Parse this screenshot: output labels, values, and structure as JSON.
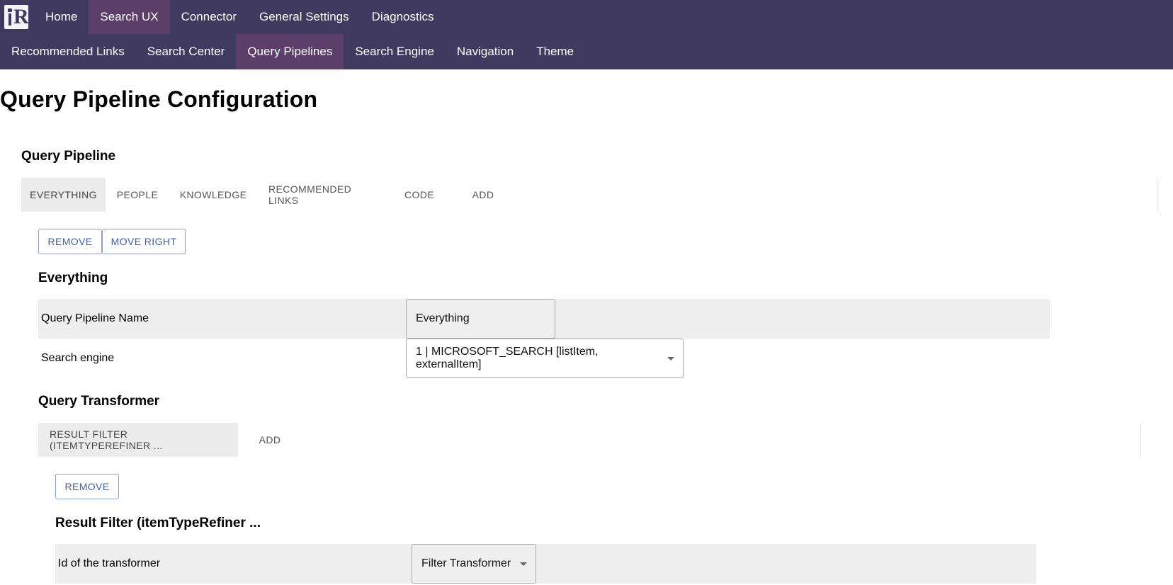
{
  "nav": {
    "top_items": [
      "Home",
      "Search UX",
      "Connector",
      "General Settings",
      "Diagnostics"
    ],
    "top_active": 1,
    "sub_items": [
      "Recommended Links",
      "Search Center",
      "Query Pipelines",
      "Search Engine",
      "Navigation",
      "Theme"
    ],
    "sub_active": 2,
    "colors": {
      "bar": "#403a60",
      "active": "#5b3f6a"
    }
  },
  "page": {
    "title": "Query Pipeline Configuration"
  },
  "pipeline": {
    "section_title": "Query Pipeline",
    "tabs": [
      "EVERYTHING",
      "PEOPLE",
      "KNOWLEDGE",
      "RECOMMENDED LINKS",
      "CODE",
      "ADD"
    ],
    "active_tab": 0,
    "remove_label": "REMOVE",
    "move_right_label": "MOVE RIGHT",
    "detail_title": "Everything",
    "name_label": "Query Pipeline Name",
    "name_value": "Everything",
    "engine_label": "Search engine",
    "engine_value": "1 | MICROSOFT_SEARCH [listItem, externalItem]"
  },
  "transformer": {
    "section_title": "Query Transformer",
    "tabs": [
      "RESULT FILTER (ITEMTYPEREFINER ...",
      "ADD"
    ],
    "active_tab": 0,
    "remove_label": "REMOVE",
    "detail_title": "Result Filter (itemTypeRefiner ...",
    "id_label": "Id of the transformer",
    "id_value": "Filter Transformer"
  },
  "icons": {
    "logo": "ir-logo",
    "dropdown": "chevron-down-icon"
  }
}
